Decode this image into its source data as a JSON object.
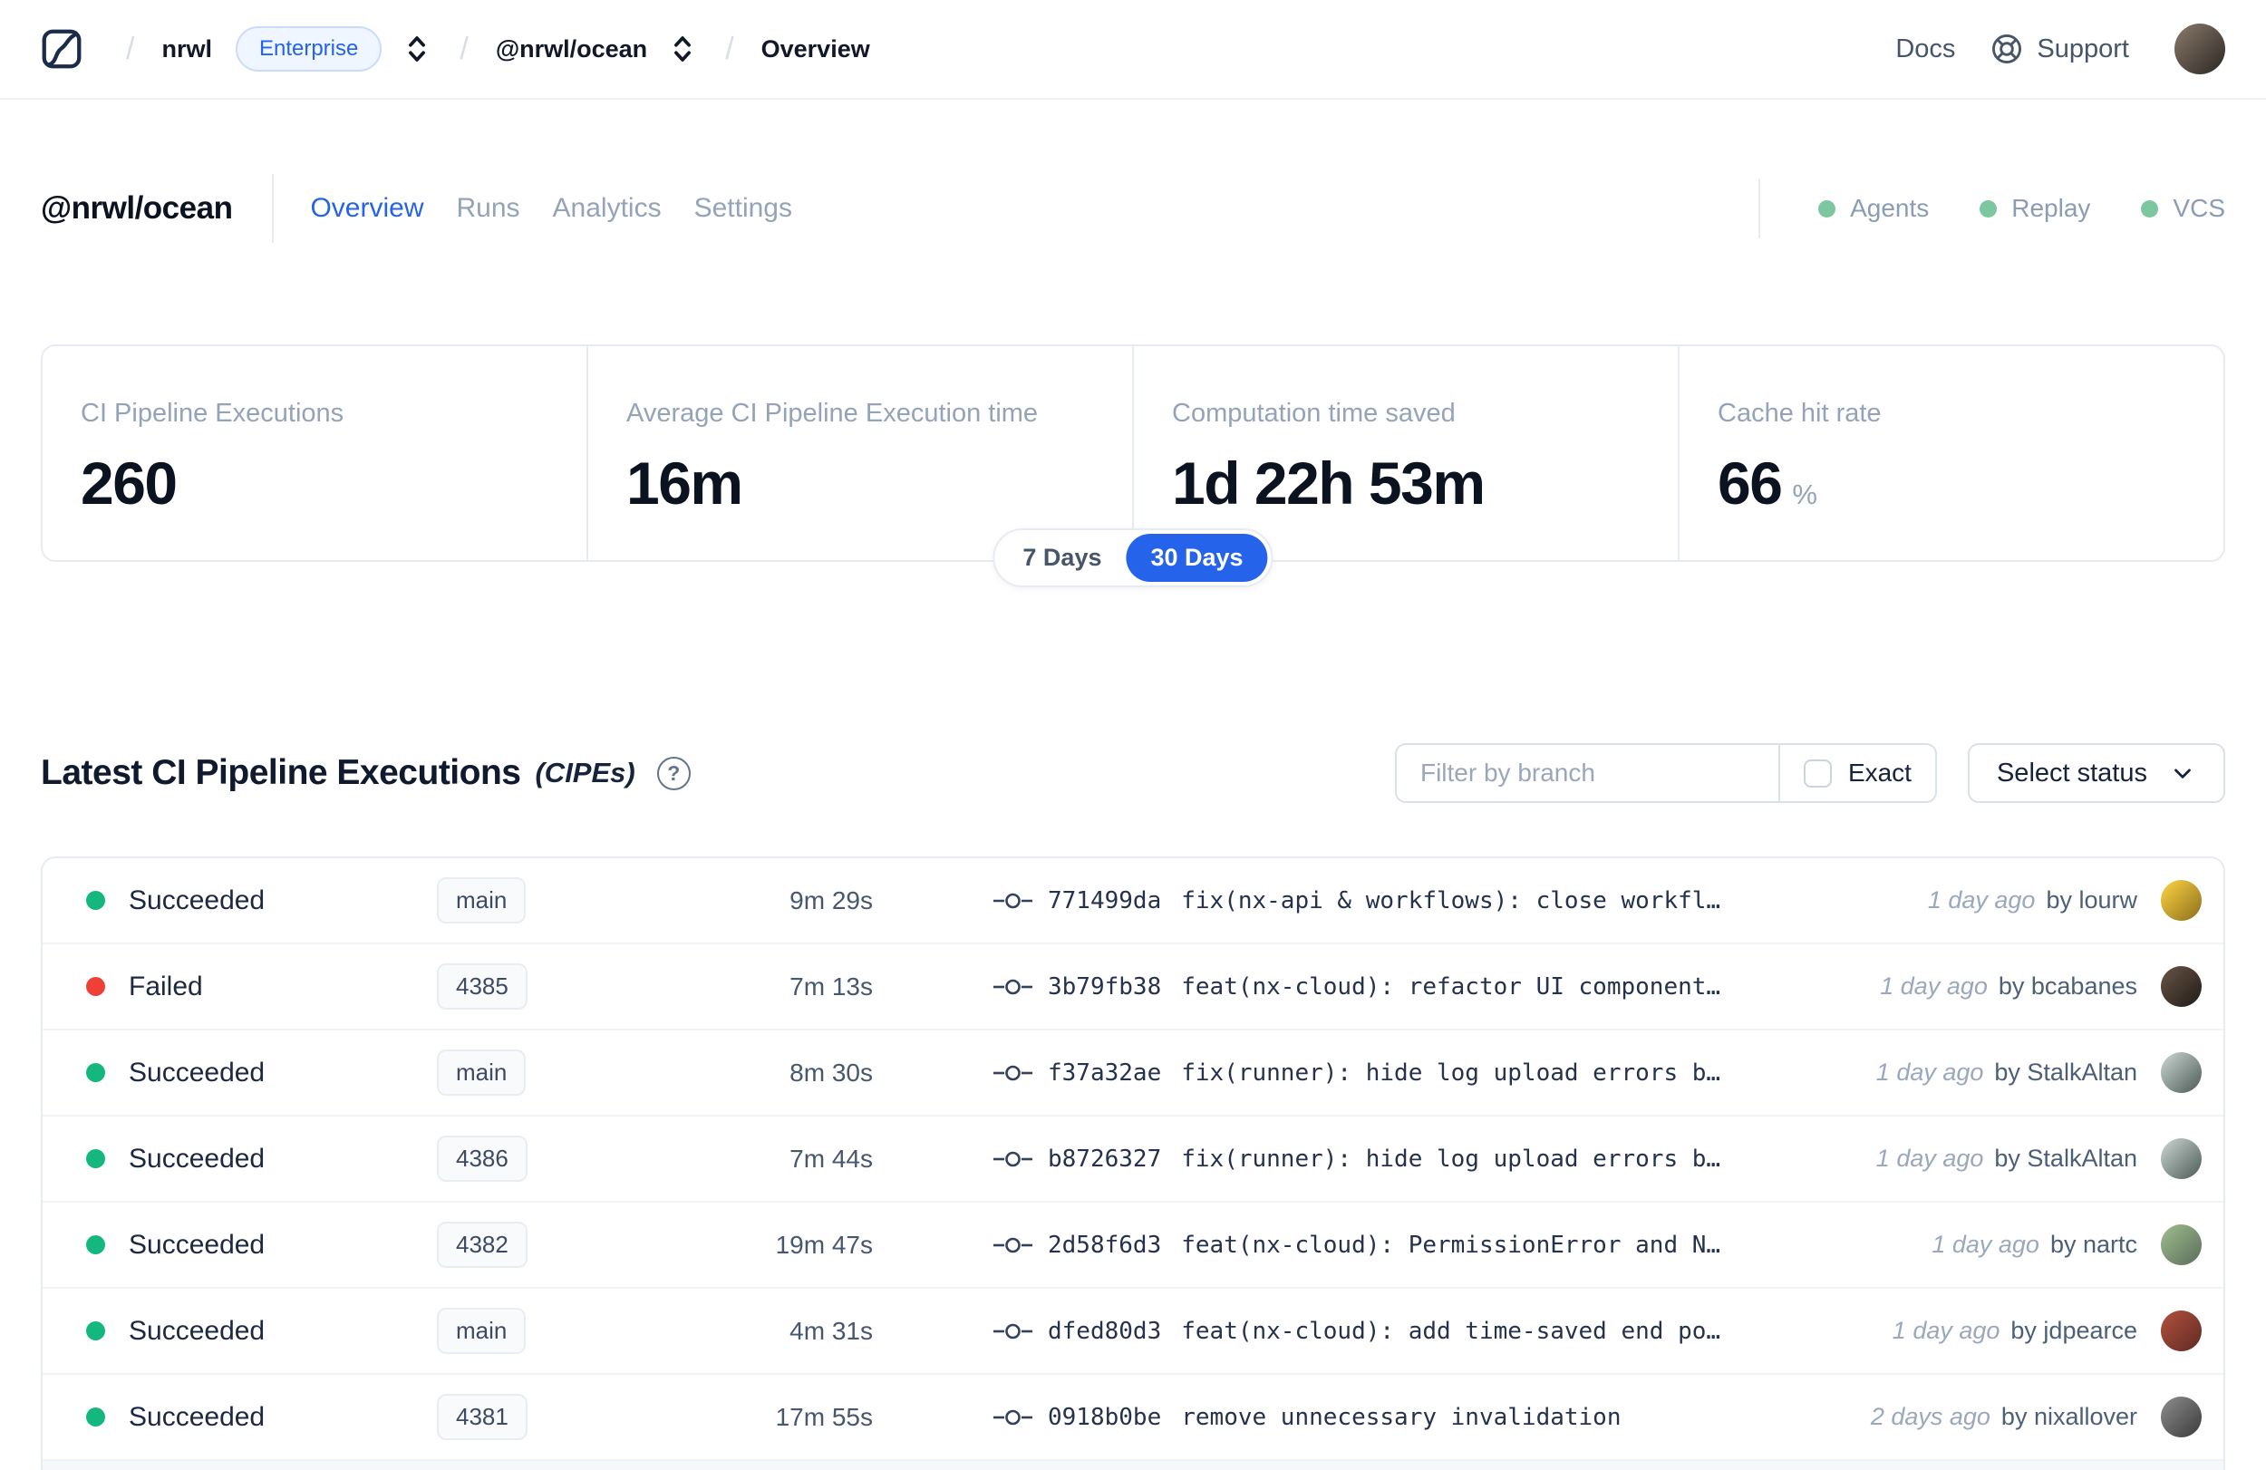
{
  "topnav": {
    "breadcrumb": {
      "org": "nrwl",
      "badge": "Enterprise",
      "workspace": "@nrwl/ocean",
      "page": "Overview"
    },
    "docs_label": "Docs",
    "support_label": "Support",
    "avatar_colors": [
      "#8a7a6b",
      "#2c2723"
    ]
  },
  "workspace": {
    "title": "@nrwl/ocean",
    "tabs": [
      {
        "label": "Overview"
      },
      {
        "label": "Runs"
      },
      {
        "label": "Analytics"
      },
      {
        "label": "Settings"
      }
    ],
    "indicators": [
      {
        "label": "Agents"
      },
      {
        "label": "Replay"
      },
      {
        "label": "VCS"
      }
    ],
    "indicator_color": "#7cc79f"
  },
  "stats": {
    "cards": [
      {
        "label": "CI Pipeline Executions",
        "value": "260",
        "suffix": ""
      },
      {
        "label": "Average CI Pipeline Execution time",
        "value": "16m",
        "suffix": ""
      },
      {
        "label": "Computation time saved",
        "value": "1d 22h 53m",
        "suffix": ""
      },
      {
        "label": "Cache hit rate",
        "value": "66",
        "suffix": "%"
      }
    ],
    "range_toggle": {
      "option_1": "7 Days",
      "option_2": "30 Days",
      "selected": "30 Days"
    }
  },
  "cipes": {
    "title": "Latest CI Pipeline Executions",
    "title_suffix": "(CIPEs)",
    "help_glyph": "?",
    "filter_placeholder": "Filter by branch",
    "exact_label": "Exact",
    "status_select_label": "Select status",
    "rows": [
      {
        "status": "Succeeded",
        "status_color": "#14b87f",
        "branch": "main",
        "duration": "9m 29s",
        "commit_hash": "771499da",
        "commit_message": "fix(nx-api & workflows): close workfl…",
        "time": "1 day ago",
        "author": "by lourw",
        "avatar": [
          "#ffd645",
          "#8a6d1a"
        ]
      },
      {
        "status": "Failed",
        "status_color": "#ee4037",
        "branch": "4385",
        "duration": "7m 13s",
        "commit_hash": "3b79fb38",
        "commit_message": "feat(nx-cloud): refactor UI component…",
        "time": "1 day ago",
        "author": "by bcabanes",
        "avatar": [
          "#6b5546",
          "#1f1b18"
        ]
      },
      {
        "status": "Succeeded",
        "status_color": "#14b87f",
        "branch": "main",
        "duration": "8m 30s",
        "commit_hash": "f37a32ae",
        "commit_message": "fix(runner): hide log upload errors b…",
        "time": "1 day ago",
        "author": "by StalkAltan",
        "avatar": [
          "#cfd8d4",
          "#4a5a55"
        ]
      },
      {
        "status": "Succeeded",
        "status_color": "#14b87f",
        "branch": "4386",
        "duration": "7m 44s",
        "commit_hash": "b8726327",
        "commit_message": "fix(runner): hide log upload errors b…",
        "time": "1 day ago",
        "author": "by StalkAltan",
        "avatar": [
          "#cfd8d4",
          "#4a5a55"
        ]
      },
      {
        "status": "Succeeded",
        "status_color": "#14b87f",
        "branch": "4382",
        "duration": "19m 47s",
        "commit_hash": "2d58f6d3",
        "commit_message": "feat(nx-cloud): PermissionError and N…",
        "time": "1 day ago",
        "author": "by nartc",
        "avatar": [
          "#9fbf8f",
          "#5b6b5a"
        ]
      },
      {
        "status": "Succeeded",
        "status_color": "#14b87f",
        "branch": "main",
        "duration": "4m 31s",
        "commit_hash": "dfed80d3",
        "commit_message": "feat(nx-cloud): add time-saved end po…",
        "time": "1 day ago",
        "author": "by jdpearce",
        "avatar": [
          "#b4513f",
          "#5e2a22"
        ]
      },
      {
        "status": "Succeeded",
        "status_color": "#14b87f",
        "branch": "4381",
        "duration": "17m 55s",
        "commit_hash": "0918b0be",
        "commit_message": "remove unnecessary invalidation",
        "time": "2 days ago",
        "author": "by nixallover",
        "avatar": [
          "#8e8e8e",
          "#3a3a3a"
        ]
      }
    ]
  }
}
